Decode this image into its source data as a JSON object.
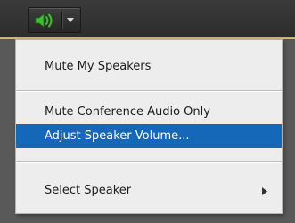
{
  "toolbar": {
    "speaker_icon": "speaker-volume-icon",
    "dropdown_icon": "caret-down-icon",
    "accent_color": "#3fbf2e",
    "strip_color": "#c9ba6d"
  },
  "menu": {
    "items": [
      {
        "label": "Mute My Speakers",
        "selected": false
      },
      {
        "label": "Mute Conference Audio Only",
        "selected": false
      },
      {
        "label": "Adjust Speaker Volume...",
        "selected": true
      },
      {
        "label": "Select Speaker",
        "selected": false,
        "has_submenu": true,
        "submenu_icon": "chevron-right-icon"
      }
    ],
    "highlight_color": "#1568b8"
  }
}
